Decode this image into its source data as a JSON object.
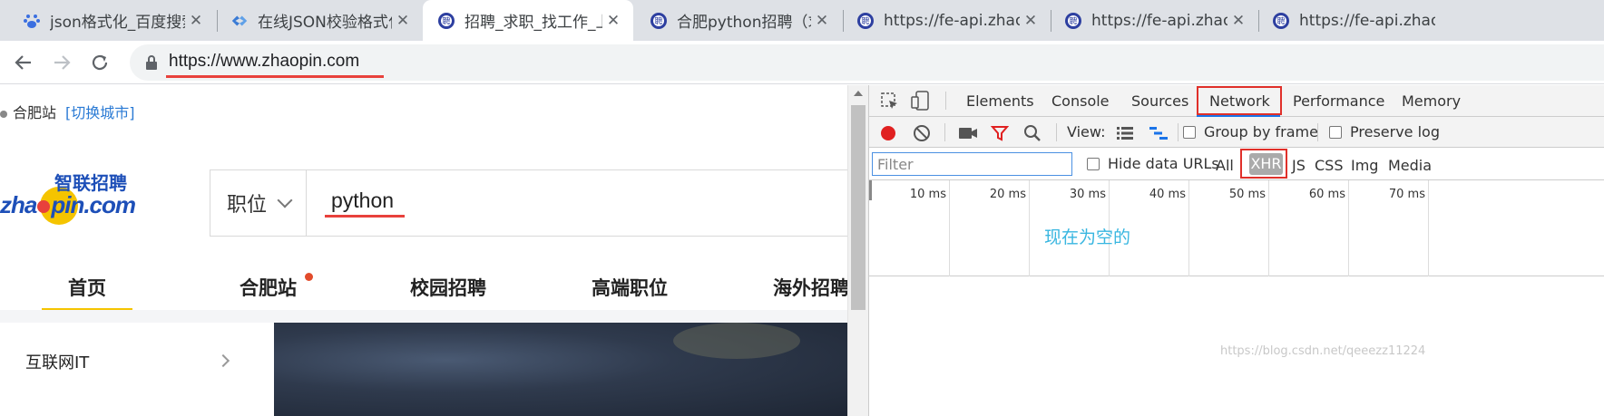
{
  "tabs": [
    {
      "title": "json格式化_百度搜索",
      "favicon": "baidu-paw-icon",
      "active": false
    },
    {
      "title": "在线JSON校验格式化工具",
      "favicon": "diamond-icon",
      "active": false
    },
    {
      "title": "招聘_求职_找工作_上智联招聘",
      "favicon": "zhaopin-icon",
      "active": true
    },
    {
      "title": "合肥python招聘（求职）",
      "favicon": "zhaopin-icon",
      "active": false
    },
    {
      "title": "https://fe-api.zhaopin.com",
      "favicon": "zhaopin-icon",
      "active": false
    },
    {
      "title": "https://fe-api.zhaopin.com",
      "favicon": "zhaopin-icon",
      "active": false
    },
    {
      "title": "https://fe-api.zhaopin.com",
      "favicon": "zhaopin-icon",
      "active": false
    }
  ],
  "close_glyph": "✕",
  "address_bar": {
    "protocol": "https://",
    "host": "www.zhaopin.com"
  },
  "page": {
    "location": "合肥站",
    "switch_city": "[切换城市]",
    "logo_cn": "智联招聘",
    "logo_en_a": "zha",
    "logo_en_b": "pin.com",
    "search_category": "职位",
    "search_keyword": "python",
    "nav": [
      {
        "label": "首页",
        "active": true
      },
      {
        "label": "合肥站",
        "badge": true
      },
      {
        "label": "校园招聘"
      },
      {
        "label": "高端职位"
      },
      {
        "label": "海外招聘"
      }
    ],
    "category_item": "互联网IT"
  },
  "devtools": {
    "tabs": [
      "Elements",
      "Console",
      "Sources",
      "Network",
      "Performance",
      "Memory"
    ],
    "active_tab": "Network",
    "view_label": "View:",
    "group_by_frame": "Group by frame",
    "preserve_log": "Preserve log",
    "filter_placeholder": "Filter",
    "hide_data_urls": "Hide data URLs",
    "type_filters": [
      "All",
      "XHR",
      "JS",
      "CSS",
      "Img",
      "Media"
    ],
    "selected_type": "XHR",
    "ticks": [
      "10 ms",
      "20 ms",
      "30 ms",
      "40 ms",
      "50 ms",
      "60 ms",
      "70 ms"
    ],
    "annotation": "现在为空的"
  },
  "watermark": "https://blog.csdn.net/qeeezz11224",
  "colors": {
    "accent_red": "#e0302a",
    "record_red": "#e02020",
    "highlight_yellow": "#f5c400",
    "annotation_cyan": "#38b6e0",
    "devtools_blue": "#1a73e8"
  }
}
